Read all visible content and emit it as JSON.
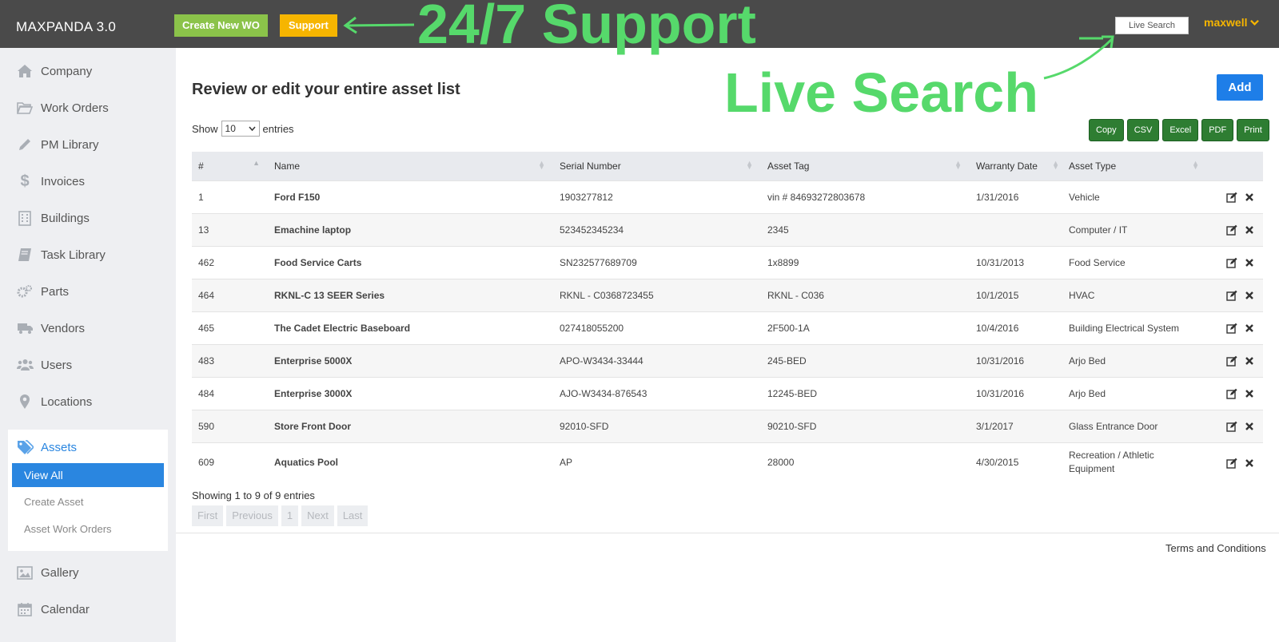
{
  "header": {
    "brand": "MAXPANDA 3.0",
    "create_wo_label": "Create New WO",
    "support_label": "Support",
    "live_search_value": "Live Search",
    "username": "maxwell"
  },
  "annotations": {
    "support": "24/7 Support",
    "search": "Live Search"
  },
  "sidebar": {
    "items": [
      {
        "label": "Company",
        "icon": "home-icon"
      },
      {
        "label": "Work Orders",
        "icon": "folder-open-icon"
      },
      {
        "label": "PM Library",
        "icon": "pencil-icon"
      },
      {
        "label": "Invoices",
        "icon": "dollar-icon"
      },
      {
        "label": "Buildings",
        "icon": "building-icon"
      },
      {
        "label": "Task Library",
        "icon": "book-icon"
      },
      {
        "label": "Parts",
        "icon": "gears-icon"
      },
      {
        "label": "Vendors",
        "icon": "truck-icon"
      },
      {
        "label": "Users",
        "icon": "users-icon"
      },
      {
        "label": "Locations",
        "icon": "map-marker-icon"
      }
    ],
    "assets": {
      "label": "Assets",
      "icon": "tags-icon",
      "subitems": [
        "View All",
        "Create Asset",
        "Asset Work Orders"
      ]
    },
    "after_items": [
      {
        "label": "Gallery",
        "icon": "image-icon"
      },
      {
        "label": "Calendar",
        "icon": "calendar-icon"
      }
    ]
  },
  "main": {
    "title": "Review or edit your entire asset list",
    "add_label": "Add",
    "show_label": "Show",
    "page_size": "10",
    "entries_label": "entries",
    "export_buttons": [
      "Copy",
      "CSV",
      "Excel",
      "PDF",
      "Print"
    ],
    "columns": [
      "#",
      "Name",
      "Serial Number",
      "Asset Tag",
      "Warranty Date",
      "Asset Type"
    ],
    "rows": [
      {
        "id": "1",
        "name": "Ford F150",
        "serial": "1903277812",
        "tag": "vin # 84693272803678",
        "warranty": "1/31/2016",
        "type": "Vehicle"
      },
      {
        "id": "13",
        "name": "Emachine laptop",
        "serial": "523452345234",
        "tag": "2345",
        "warranty": "",
        "type": "Computer / IT"
      },
      {
        "id": "462",
        "name": "Food Service Carts",
        "serial": "SN232577689709",
        "tag": "1x8899",
        "warranty": "10/31/2013",
        "type": "Food Service"
      },
      {
        "id": "464",
        "name": "RKNL-C 13 SEER Series",
        "serial": "RKNL - C0368723455",
        "tag": "RKNL - C036",
        "warranty": "10/1/2015",
        "type": "HVAC"
      },
      {
        "id": "465",
        "name": "The Cadet Electric Baseboard",
        "serial": "027418055200",
        "tag": "2F500-1A",
        "warranty": "10/4/2016",
        "type": "Building Electrical System"
      },
      {
        "id": "483",
        "name": "Enterprise 5000X",
        "serial": "APO-W3434-33444",
        "tag": "245-BED",
        "warranty": "10/31/2016",
        "type": "Arjo Bed"
      },
      {
        "id": "484",
        "name": "Enterprise 3000X",
        "serial": "AJO-W3434-876543",
        "tag": "12245-BED",
        "warranty": "10/31/2016",
        "type": "Arjo Bed"
      },
      {
        "id": "590",
        "name": "Store Front Door",
        "serial": "92010-SFD",
        "tag": "90210-SFD",
        "warranty": "3/1/2017",
        "type": "Glass Entrance Door"
      },
      {
        "id": "609",
        "name": "Aquatics Pool",
        "serial": "AP",
        "tag": "28000",
        "warranty": "4/30/2015",
        "type": "Recreation / Athletic Equipment"
      }
    ],
    "showing_text": "Showing 1 to 9 of 9 entries",
    "pager": [
      "First",
      "Previous",
      "1",
      "Next",
      "Last"
    ]
  },
  "footer": {
    "terms": "Terms and Conditions"
  },
  "colors": {
    "topbar": "#4a4a4a",
    "accent_blue": "#2a86e0",
    "support_yellow": "#f6b500",
    "wo_green": "#8bc34a",
    "export_green": "#2e7d32",
    "annotation_green": "#56d96b"
  }
}
